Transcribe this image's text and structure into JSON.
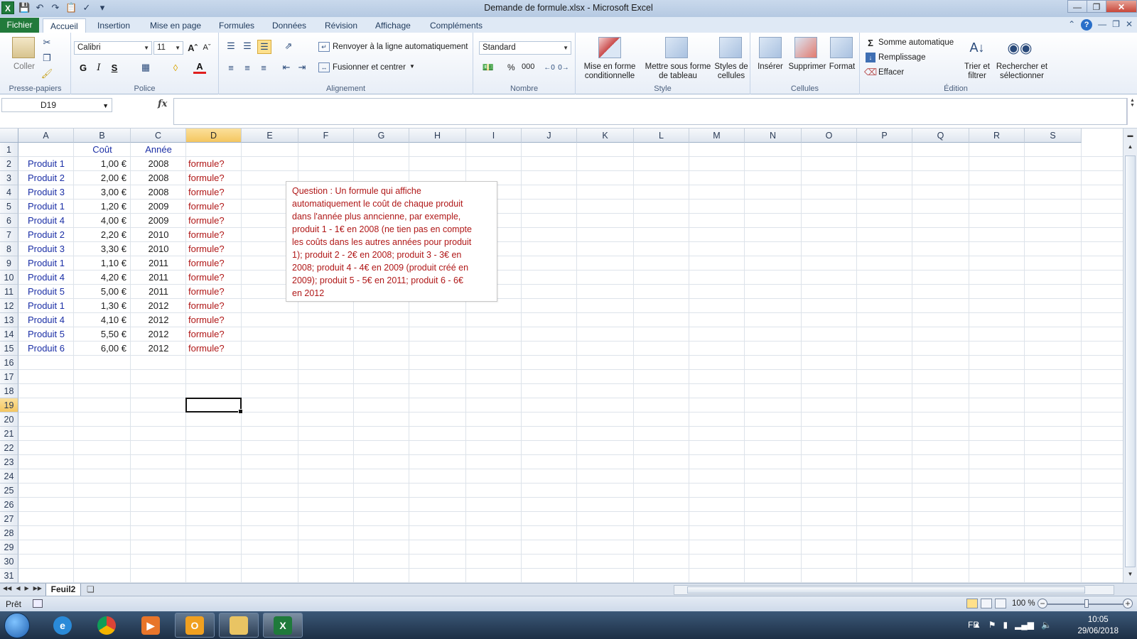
{
  "window": {
    "title": "Demande de formule.xlsx  -  Microsoft Excel",
    "app_icon": "X"
  },
  "tabs": {
    "file": "Fichier",
    "items": [
      "Accueil",
      "Insertion",
      "Mise en page",
      "Formules",
      "Données",
      "Révision",
      "Affichage",
      "Compléments"
    ],
    "active": "Accueil"
  },
  "ribbon": {
    "clipboard": {
      "label": "Presse-papiers",
      "paste": "Coller"
    },
    "font": {
      "label": "Police",
      "name": "Calibri",
      "size": "11",
      "bold": "G",
      "italic": "I",
      "underline": "S",
      "font_color_letter": "A"
    },
    "alignment": {
      "label": "Alignement",
      "wrap": "Renvoyer à la ligne automatiquement",
      "merge": "Fusionner et centrer"
    },
    "number": {
      "label": "Nombre",
      "format": "Standard",
      "percent": "%",
      "thousands": "000"
    },
    "style": {
      "label": "Style",
      "cond": "Mise en forme conditionnelle",
      "table": "Mettre sous forme de tableau",
      "cellstyles": "Styles de cellules"
    },
    "cells": {
      "label": "Cellules",
      "insert": "Insérer",
      "delete": "Supprimer",
      "format": "Format"
    },
    "editing": {
      "label": "Édition",
      "autosum": "Somme automatique",
      "fill": "Remplissage",
      "clear": "Effacer",
      "sort": "Trier et filtrer",
      "find": "Rechercher et sélectionner"
    }
  },
  "formula_bar": {
    "name_box": "D19",
    "fx": "fx",
    "value": ""
  },
  "columns": [
    "A",
    "B",
    "C",
    "D",
    "E",
    "F",
    "G",
    "H",
    "I",
    "J",
    "K",
    "L",
    "M",
    "N",
    "O",
    "P",
    "Q",
    "R",
    "S"
  ],
  "selected_column": "D",
  "selected_row": "19",
  "rows": [
    "1",
    "2",
    "3",
    "4",
    "5",
    "6",
    "7",
    "8",
    "9",
    "10",
    "11",
    "12",
    "13",
    "14",
    "15",
    "16",
    "17",
    "18",
    "19",
    "20",
    "21",
    "22",
    "23",
    "24",
    "25",
    "26",
    "27",
    "28",
    "29",
    "30",
    "31"
  ],
  "sheet": {
    "headers": {
      "B": "Coût",
      "C": "Année"
    },
    "data": [
      {
        "A": "Produit 1",
        "B": "1,00 €",
        "C": "2008",
        "D": "formule?"
      },
      {
        "A": "Produit 2",
        "B": "2,00 €",
        "C": "2008",
        "D": "formule?"
      },
      {
        "A": "Produit 3",
        "B": "3,00 €",
        "C": "2008",
        "D": "formule?"
      },
      {
        "A": "Produit 1",
        "B": "1,20 €",
        "C": "2009",
        "D": "formule?"
      },
      {
        "A": "Produit 4",
        "B": "4,00 €",
        "C": "2009",
        "D": "formule?"
      },
      {
        "A": "Produit 2",
        "B": "2,20 €",
        "C": "2010",
        "D": "formule?"
      },
      {
        "A": "Produit 3",
        "B": "3,30 €",
        "C": "2010",
        "D": "formule?"
      },
      {
        "A": "Produit 1",
        "B": "1,10 €",
        "C": "2011",
        "D": "formule?"
      },
      {
        "A": "Produit 4",
        "B": "4,20 €",
        "C": "2011",
        "D": "formule?"
      },
      {
        "A": "Produit 5",
        "B": "5,00 €",
        "C": "2011",
        "D": "formule?"
      },
      {
        "A": "Produit 1",
        "B": "1,30 €",
        "C": "2012",
        "D": "formule?"
      },
      {
        "A": "Produit 4",
        "B": "4,10 €",
        "C": "2012",
        "D": "formule?"
      },
      {
        "A": "Produit 5",
        "B": "5,50 €",
        "C": "2012",
        "D": "formule?"
      },
      {
        "A": "Produit 6",
        "B": "6,00 €",
        "C": "2012",
        "D": "formule?"
      }
    ]
  },
  "textbox": {
    "lines": [
      "Question : Un formule qui affiche",
      "automatiquement le coût de chaque produit",
      "dans l'année plus anncienne, par exemple,",
      "produit 1 - 1€ en 2008  (ne tien pas en compte",
      "les coûts dans les autres années pour produit",
      "1); produit 2 - 2€ en 2008;  produit 3 - 3€ en",
      "2008;  produit 4 - 4€ en 2009  (produit créé en",
      "2009); produit 5 - 5€ en 2011;  produit 6 - 6€",
      "en 2012"
    ]
  },
  "sheet_tabs": {
    "active": "Feuil2"
  },
  "status": {
    "ready": "Prêt",
    "zoom": "100 %",
    "zoom_fraction": 0.5
  },
  "taskbar": {
    "lang": "FR",
    "time": "10:05",
    "date": "29/06/2018"
  },
  "colors": {
    "product_blue": "#1b2fa6",
    "formula_red": "#b01818",
    "file_tab_green": "#227a3b"
  }
}
